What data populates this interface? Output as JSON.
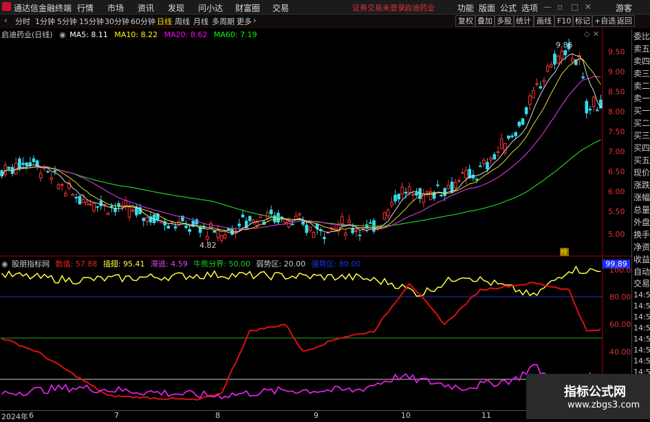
{
  "titlebar": {
    "app": "通达信金融终端",
    "menus": [
      "行情",
      "市场",
      "资讯",
      "发现",
      "问小达",
      "财富圈",
      "交易"
    ],
    "warn": [
      "证券交易未登录",
      "启迪药业"
    ],
    "right_menus": [
      "功能",
      "版面",
      "公式",
      "选项"
    ],
    "guest": "游客"
  },
  "toolbar": {
    "periods": [
      "分时",
      "1分钟",
      "5分钟",
      "15分钟",
      "30分钟",
      "60分钟",
      "日线",
      "周线",
      "月线",
      "多周期",
      "更多"
    ],
    "active": "日线",
    "right": [
      "复权",
      "叠加",
      "多股",
      "统计",
      "画线",
      "F10",
      "标记",
      "+自选",
      "返回"
    ]
  },
  "legend": {
    "title": "启迪药业(日线)",
    "ma5": "MA5: 8.11",
    "ma10": "MA10: 8.22",
    "ma20": "MA20: 8.62",
    "ma60": "MA60: 7.19",
    "colors": {
      "ma5": "#ffffff",
      "ma10": "#ffff00",
      "ma20": "#ff00ff",
      "ma60": "#00ff00"
    }
  },
  "annotations": {
    "high": "9.86",
    "low": "4.82",
    "badge": "榜"
  },
  "indicator": {
    "name": "股朋指标网",
    "v1": "数值: 57.88",
    "v2": "插翅: 95.41",
    "v3": "滞逃: 4.59",
    "v4": "牛熊分界: 50.00",
    "v5": "弱势区: 20.00",
    "v6": "强势区: 80.00",
    "current": "99.89"
  },
  "price_axis": [
    "9.50",
    "9.00",
    "8.50",
    "8.00",
    "7.50",
    "7.00",
    "6.50",
    "6.00",
    "5.50",
    "5.00"
  ],
  "ind_axis": [
    "100.0",
    "80.00",
    "60.00",
    "40.00"
  ],
  "side_panel": [
    "委比",
    "卖五",
    "卖四",
    "卖三",
    "卖二",
    "卖一",
    "买一",
    "买二",
    "买三",
    "买四",
    "买五",
    "现价",
    "涨跌",
    "涨幅",
    "总量",
    "外盘",
    "换手",
    "净资",
    "收益"
  ],
  "side_lower": [
    "自动",
    "交易"
  ],
  "times": [
    "14:55",
    "14:55",
    "14:56",
    "14:56",
    "14:56",
    "14:56",
    "14:56",
    "14:56"
  ],
  "dates": [
    "2024年",
    "6",
    "7",
    "8",
    "9",
    "10",
    "11"
  ],
  "watermark": {
    "title": "指标公式网",
    "url": "www.zbgs3.com"
  }
}
